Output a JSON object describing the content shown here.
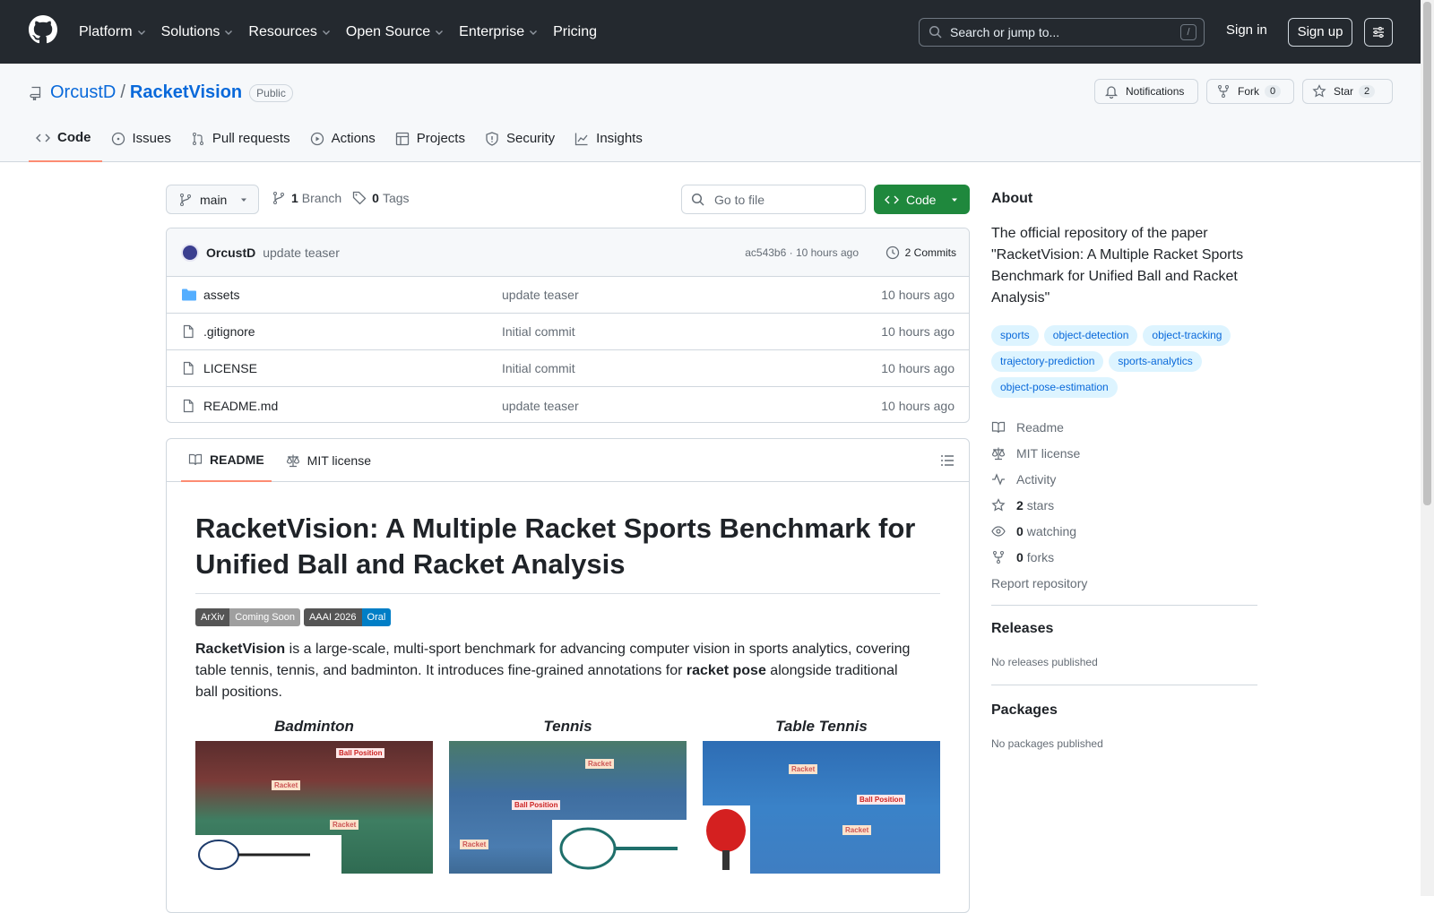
{
  "nav": {
    "items": [
      "Platform",
      "Solutions",
      "Resources",
      "Open Source",
      "Enterprise",
      "Pricing"
    ],
    "search_placeholder": "Search or jump to...",
    "search_shortcut": "/",
    "sign_in": "Sign in",
    "sign_up": "Sign up"
  },
  "repo": {
    "owner": "OrcustD",
    "separator": "/",
    "name": "RacketVision",
    "visibility": "Public",
    "notifications_label": "Notifications",
    "fork_label": "Fork",
    "fork_count": "0",
    "star_label": "Star",
    "star_count": "2"
  },
  "tabs": [
    "Code",
    "Issues",
    "Pull requests",
    "Actions",
    "Projects",
    "Security",
    "Insights"
  ],
  "branch": {
    "name": "main",
    "branch_count": "1",
    "branch_label": "Branch",
    "tag_count": "0",
    "tag_label": "Tags",
    "go_to_file": "Go to file",
    "code_button": "Code"
  },
  "commit": {
    "author": "OrcustD",
    "message": "update teaser",
    "hash_time": "ac543b6 · 10 hours ago",
    "commits": "2 Commits"
  },
  "files": [
    {
      "name": "assets",
      "type": "folder",
      "message": "update teaser",
      "time": "10 hours ago"
    },
    {
      "name": ".gitignore",
      "type": "file",
      "message": "Initial commit",
      "time": "10 hours ago"
    },
    {
      "name": "LICENSE",
      "type": "file",
      "message": "Initial commit",
      "time": "10 hours ago"
    },
    {
      "name": "README.md",
      "type": "file",
      "message": "update teaser",
      "time": "10 hours ago"
    }
  ],
  "readme": {
    "tab_readme": "README",
    "tab_license": "MIT license",
    "title": "RacketVision: A Multiple Racket Sports Benchmark for Unified Ball and Racket Analysis",
    "badges": [
      {
        "left": "ArXiv",
        "right": "Coming Soon",
        "color": "#9f9f9f"
      },
      {
        "left": "AAAI 2026",
        "right": "Oral",
        "color": "#007ec6"
      }
    ],
    "para_strong": "RacketVision",
    "para_a": " is a large-scale, multi-sport benchmark for advancing computer vision in sports analytics, covering table tennis, tennis, and badminton. It introduces fine-grained annotations for ",
    "para_strong2": "racket pose",
    "para_b": " alongside traditional ball positions.",
    "figures": [
      "Badminton",
      "Tennis",
      "Table Tennis"
    ],
    "fig_labels": {
      "ball": "Ball Position",
      "racket": "Racket"
    }
  },
  "about": {
    "heading": "About",
    "description": "The official repository of the paper \"RacketVision: A Multiple Racket Sports Benchmark for Unified Ball and Racket Analysis\"",
    "topics": [
      "sports",
      "object-detection",
      "object-tracking",
      "trajectory-prediction",
      "sports-analytics",
      "object-pose-estimation"
    ],
    "readme": "Readme",
    "license": "MIT license",
    "activity": "Activity",
    "stars_count": "2",
    "stars_label": "stars",
    "watching_count": "0",
    "watching_label": "watching",
    "forks_count": "0",
    "forks_label": "forks",
    "report": "Report repository"
  },
  "releases": {
    "heading": "Releases",
    "empty": "No releases published"
  },
  "packages": {
    "heading": "Packages",
    "empty": "No packages published"
  },
  "colors": {
    "accent": "#0969da",
    "green": "#1f883d",
    "header": "#24292f",
    "tab_underline": "#fd8c73"
  }
}
